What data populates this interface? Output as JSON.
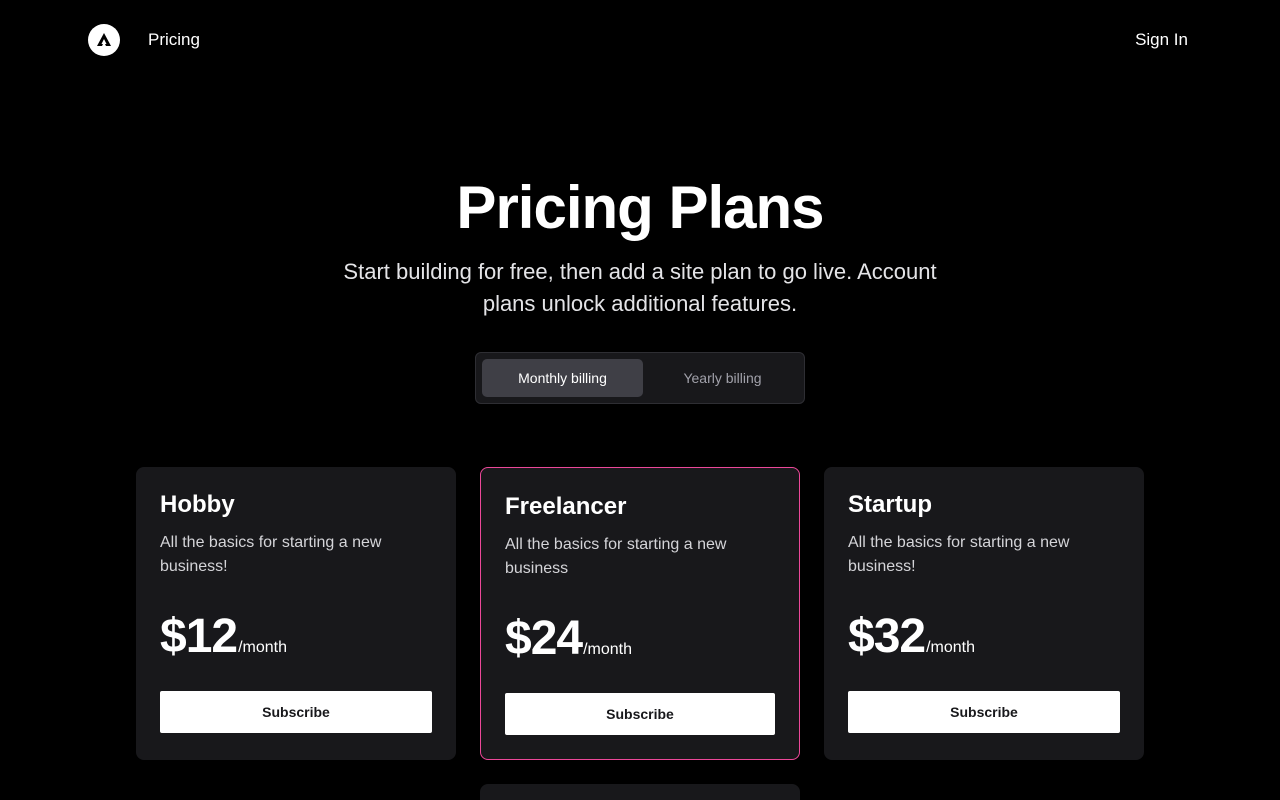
{
  "header": {
    "logo_icon": "triangle-logo-icon",
    "nav_pricing": "Pricing",
    "sign_in": "Sign In"
  },
  "hero": {
    "title": "Pricing Plans",
    "subtitle": "Start building for free, then add a site plan to go live. Account plans unlock additional features."
  },
  "billing": {
    "monthly_label": "Monthly billing",
    "yearly_label": "Yearly billing",
    "selected": "monthly"
  },
  "plans": [
    {
      "name": "Hobby",
      "description": "All the basics for starting a new business!",
      "price": "$12",
      "period": "/month",
      "button": "Subscribe",
      "featured": false
    },
    {
      "name": "Freelancer",
      "description": "All the basics for starting a new business",
      "price": "$24",
      "period": "/month",
      "button": "Subscribe",
      "featured": true
    },
    {
      "name": "Startup",
      "description": "All the basics for starting a new business!",
      "price": "$32",
      "period": "/month",
      "button": "Subscribe",
      "featured": false
    }
  ],
  "colors": {
    "background": "#000000",
    "card_background": "#18181b",
    "featured_border": "#ec4899",
    "toggle_active": "#3f3f46",
    "button_background": "#ffffff"
  }
}
